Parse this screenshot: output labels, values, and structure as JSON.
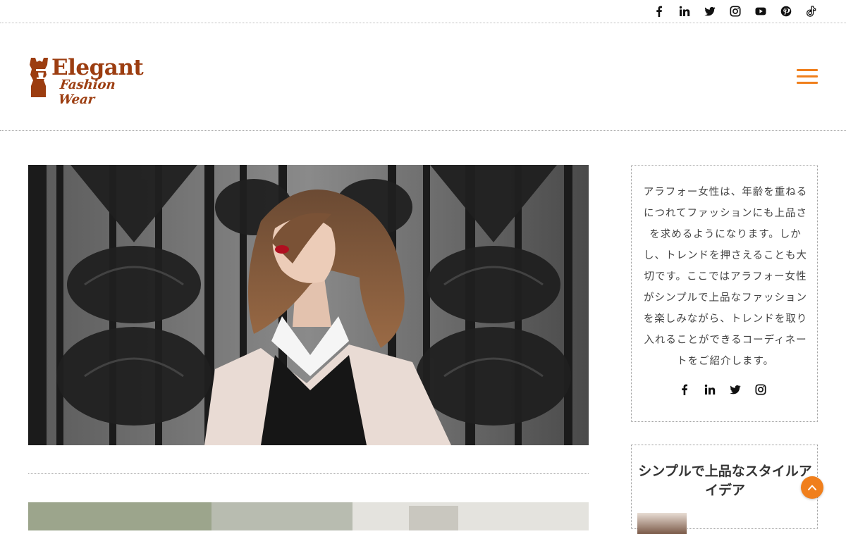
{
  "site": {
    "logo": {
      "word1": "Elegant",
      "word2": "Fashion Wear"
    }
  },
  "top_social": [
    {
      "icon": "facebook-icon"
    },
    {
      "icon": "linkedin-icon"
    },
    {
      "icon": "twitter-icon"
    },
    {
      "icon": "instagram-icon"
    },
    {
      "icon": "youtube-icon"
    },
    {
      "icon": "pinterest-icon"
    },
    {
      "icon": "tiktok-icon"
    }
  ],
  "colors": {
    "accent": "#f07f1c",
    "logo": "#9c3d10"
  },
  "sidebar": {
    "about_text": "アラフォー女性は、年齢を重ねるにつれてファッションにも上品さを求めるようになります。しかし、トレンドを押さえることも大切です。ここではアラフォー女性がシンプルで上品なファッションを楽しみながら、トレンドを取り入れることができるコーディネートをご紹介します。",
    "social": [
      {
        "icon": "facebook-icon"
      },
      {
        "icon": "linkedin-icon"
      },
      {
        "icon": "twitter-icon"
      },
      {
        "icon": "instagram-icon"
      }
    ],
    "widget_title": "シンプルで上品なスタイルアイデア"
  }
}
